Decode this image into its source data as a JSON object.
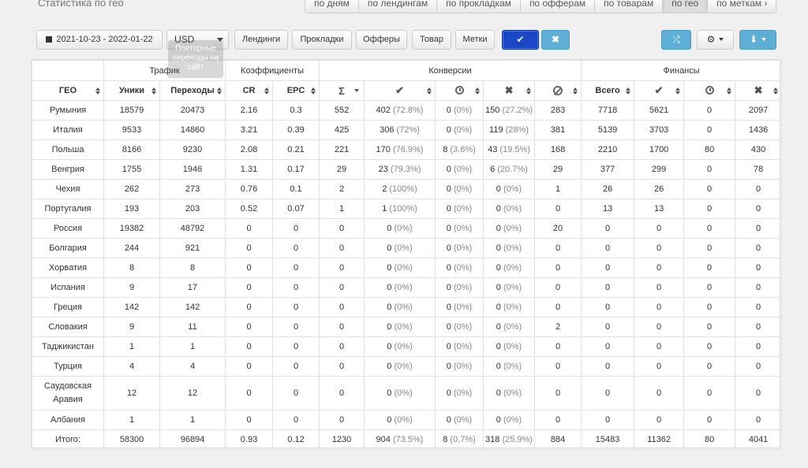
{
  "page_title": "Статистика по гео",
  "tabs": [
    "по дням",
    "по лендингам",
    "по прокладкам",
    "по офферам",
    "по товарам",
    "по гео",
    "по меткам ›"
  ],
  "active_tab": "по гео",
  "toolbar": {
    "date_range": "2021-10-23 - 2022-01-22",
    "currency": "USD",
    "filters": [
      "Лендинги",
      "Прокладки",
      "Офферы",
      "Товар",
      "Метки"
    ],
    "apply": "✔",
    "cancel": "✖",
    "shuffle": "⤮",
    "settings": "⚙",
    "export": "⬇"
  },
  "tooltip": "Повторные переходы на сайт",
  "groups": {
    "traffic": "Трафик",
    "ratios": "Коэффициенты",
    "conversions": "Конверсии",
    "finance": "Финансы"
  },
  "columns": {
    "geo": "ГЕО",
    "uniques": "Уники",
    "clicks": "Переходы",
    "cr": "CR",
    "epc": "EPC",
    "sum": "Σ",
    "approved": "✔",
    "hold": "",
    "rejected": "✖",
    "trash": "",
    "fin_total": "Всего",
    "fin_approved": "✔",
    "fin_hold": "",
    "fin_rejected": "✖"
  },
  "rows": [
    {
      "geo": "Румыния",
      "uniques": "18579",
      "clicks": "20473",
      "cr": "2.16",
      "epc": "0.3",
      "sum": "552",
      "approved": "402",
      "approved_pct": "(72.8%)",
      "hold": "0",
      "hold_pct": "(0%)",
      "rejected": "150",
      "rejected_pct": "(27.2%)",
      "trash": "283",
      "fin_total": "7718",
      "fin_approved": "5621",
      "fin_hold": "0",
      "fin_rejected": "2097"
    },
    {
      "geo": "Италия",
      "uniques": "9533",
      "clicks": "14860",
      "cr": "3.21",
      "epc": "0.39",
      "sum": "425",
      "approved": "306",
      "approved_pct": "(72%)",
      "hold": "0",
      "hold_pct": "(0%)",
      "rejected": "119",
      "rejected_pct": "(28%)",
      "trash": "381",
      "fin_total": "5139",
      "fin_approved": "3703",
      "fin_hold": "0",
      "fin_rejected": "1436"
    },
    {
      "geo": "Польша",
      "uniques": "8166",
      "clicks": "9230",
      "cr": "2.08",
      "epc": "0.21",
      "sum": "221",
      "approved": "170",
      "approved_pct": "(76.9%)",
      "hold": "8",
      "hold_pct": "(3.6%)",
      "rejected": "43",
      "rejected_pct": "(19.5%)",
      "trash": "168",
      "fin_total": "2210",
      "fin_approved": "1700",
      "fin_hold": "80",
      "fin_rejected": "430"
    },
    {
      "geo": "Венгрия",
      "uniques": "1755",
      "clicks": "1946",
      "cr": "1.31",
      "epc": "0.17",
      "sum": "29",
      "approved": "23",
      "approved_pct": "(79.3%)",
      "hold": "0",
      "hold_pct": "(0%)",
      "rejected": "6",
      "rejected_pct": "(20.7%)",
      "trash": "29",
      "fin_total": "377",
      "fin_approved": "299",
      "fin_hold": "0",
      "fin_rejected": "78"
    },
    {
      "geo": "Чехия",
      "uniques": "262",
      "clicks": "273",
      "cr": "0.76",
      "epc": "0.1",
      "sum": "2",
      "approved": "2",
      "approved_pct": "(100%)",
      "hold": "0",
      "hold_pct": "(0%)",
      "rejected": "0",
      "rejected_pct": "(0%)",
      "trash": "1",
      "fin_total": "26",
      "fin_approved": "26",
      "fin_hold": "0",
      "fin_rejected": "0"
    },
    {
      "geo": "Португалия",
      "uniques": "193",
      "clicks": "203",
      "cr": "0.52",
      "epc": "0.07",
      "sum": "1",
      "approved": "1",
      "approved_pct": "(100%)",
      "hold": "0",
      "hold_pct": "(0%)",
      "rejected": "0",
      "rejected_pct": "(0%)",
      "trash": "0",
      "fin_total": "13",
      "fin_approved": "13",
      "fin_hold": "0",
      "fin_rejected": "0"
    },
    {
      "geo": "Россия",
      "uniques": "19382",
      "clicks": "48792",
      "cr": "0",
      "epc": "0",
      "sum": "0",
      "approved": "0",
      "approved_pct": "(0%)",
      "hold": "0",
      "hold_pct": "(0%)",
      "rejected": "0",
      "rejected_pct": "(0%)",
      "trash": "20",
      "fin_total": "0",
      "fin_approved": "0",
      "fin_hold": "0",
      "fin_rejected": "0"
    },
    {
      "geo": "Болгария",
      "uniques": "244",
      "clicks": "921",
      "cr": "0",
      "epc": "0",
      "sum": "0",
      "approved": "0",
      "approved_pct": "(0%)",
      "hold": "0",
      "hold_pct": "(0%)",
      "rejected": "0",
      "rejected_pct": "(0%)",
      "trash": "0",
      "fin_total": "0",
      "fin_approved": "0",
      "fin_hold": "0",
      "fin_rejected": "0"
    },
    {
      "geo": "Хорватия",
      "uniques": "8",
      "clicks": "8",
      "cr": "0",
      "epc": "0",
      "sum": "0",
      "approved": "0",
      "approved_pct": "(0%)",
      "hold": "0",
      "hold_pct": "(0%)",
      "rejected": "0",
      "rejected_pct": "(0%)",
      "trash": "0",
      "fin_total": "0",
      "fin_approved": "0",
      "fin_hold": "0",
      "fin_rejected": "0"
    },
    {
      "geo": "Испания",
      "uniques": "9",
      "clicks": "17",
      "cr": "0",
      "epc": "0",
      "sum": "0",
      "approved": "0",
      "approved_pct": "(0%)",
      "hold": "0",
      "hold_pct": "(0%)",
      "rejected": "0",
      "rejected_pct": "(0%)",
      "trash": "0",
      "fin_total": "0",
      "fin_approved": "0",
      "fin_hold": "0",
      "fin_rejected": "0"
    },
    {
      "geo": "Греция",
      "uniques": "142",
      "clicks": "142",
      "cr": "0",
      "epc": "0",
      "sum": "0",
      "approved": "0",
      "approved_pct": "(0%)",
      "hold": "0",
      "hold_pct": "(0%)",
      "rejected": "0",
      "rejected_pct": "(0%)",
      "trash": "0",
      "fin_total": "0",
      "fin_approved": "0",
      "fin_hold": "0",
      "fin_rejected": "0"
    },
    {
      "geo": "Словакия",
      "uniques": "9",
      "clicks": "11",
      "cr": "0",
      "epc": "0",
      "sum": "0",
      "approved": "0",
      "approved_pct": "(0%)",
      "hold": "0",
      "hold_pct": "(0%)",
      "rejected": "0",
      "rejected_pct": "(0%)",
      "trash": "2",
      "fin_total": "0",
      "fin_approved": "0",
      "fin_hold": "0",
      "fin_rejected": "0"
    },
    {
      "geo": "Таджикистан",
      "uniques": "1",
      "clicks": "1",
      "cr": "0",
      "epc": "0",
      "sum": "0",
      "approved": "0",
      "approved_pct": "(0%)",
      "hold": "0",
      "hold_pct": "(0%)",
      "rejected": "0",
      "rejected_pct": "(0%)",
      "trash": "0",
      "fin_total": "0",
      "fin_approved": "0",
      "fin_hold": "0",
      "fin_rejected": "0"
    },
    {
      "geo": "Турция",
      "uniques": "4",
      "clicks": "4",
      "cr": "0",
      "epc": "0",
      "sum": "0",
      "approved": "0",
      "approved_pct": "(0%)",
      "hold": "0",
      "hold_pct": "(0%)",
      "rejected": "0",
      "rejected_pct": "(0%)",
      "trash": "0",
      "fin_total": "0",
      "fin_approved": "0",
      "fin_hold": "0",
      "fin_rejected": "0"
    },
    {
      "geo": "Саудовская Аравия",
      "uniques": "12",
      "clicks": "12",
      "cr": "0",
      "epc": "0",
      "sum": "0",
      "approved": "0",
      "approved_pct": "(0%)",
      "hold": "0",
      "hold_pct": "(0%)",
      "rejected": "0",
      "rejected_pct": "(0%)",
      "trash": "0",
      "fin_total": "0",
      "fin_approved": "0",
      "fin_hold": "0",
      "fin_rejected": "0"
    },
    {
      "geo": "Албания",
      "uniques": "1",
      "clicks": "1",
      "cr": "0",
      "epc": "0",
      "sum": "0",
      "approved": "0",
      "approved_pct": "(0%)",
      "hold": "0",
      "hold_pct": "(0%)",
      "rejected": "0",
      "rejected_pct": "(0%)",
      "trash": "0",
      "fin_total": "0",
      "fin_approved": "0",
      "fin_hold": "0",
      "fin_rejected": "0"
    }
  ],
  "totals": {
    "geo": "Итого:",
    "uniques": "58300",
    "clicks": "96894",
    "cr": "0.93",
    "epc": "0.12",
    "sum": "1230",
    "approved": "904",
    "approved_pct": "(73.5%)",
    "hold": "8",
    "hold_pct": "(0.7%)",
    "rejected": "318",
    "rejected_pct": "(25.9%)",
    "trash": "884",
    "fin_total": "15483",
    "fin_approved": "11362",
    "fin_hold": "80",
    "fin_rejected": "4041"
  }
}
